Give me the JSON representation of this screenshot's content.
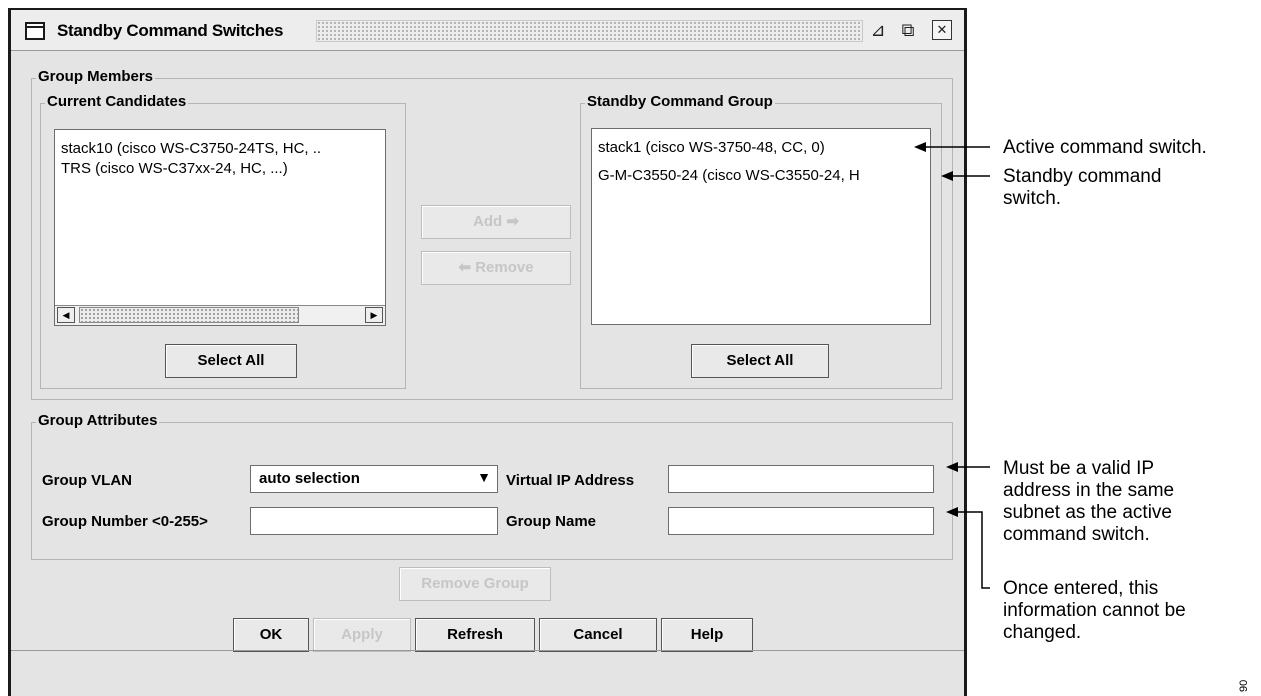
{
  "window": {
    "title": "Standby Command Switches"
  },
  "group_members": {
    "legend": "Group Members",
    "current_candidates": {
      "legend": "Current Candidates",
      "items": [
        "stack10 (cisco WS-C3750-24TS, HC, ..",
        "TRS (cisco WS-C37xx-24, HC, ...)"
      ],
      "select_all_label": "Select All"
    },
    "add_label": "Add",
    "remove_label": "Remove",
    "standby_group": {
      "legend": "Standby Command Group",
      "items": [
        "stack1 (cisco WS-3750-48, CC, 0)",
        "G-M-C3550-24 (cisco WS-C3550-24, H"
      ],
      "select_all_label": "Select All"
    }
  },
  "group_attributes": {
    "legend": "Group Attributes",
    "vlan_label": "Group VLAN",
    "vlan_value": "auto selection",
    "number_label": "Group Number <0-255>",
    "virtual_ip_label": "Virtual IP Address",
    "name_label": "Group Name"
  },
  "buttons": {
    "remove_group": "Remove Group",
    "ok": "OK",
    "apply": "Apply",
    "refresh": "Refresh",
    "cancel": "Cancel",
    "help": "Help"
  },
  "annotations": {
    "active": "Active command switch.",
    "standby_1": "Standby command",
    "standby_2": "switch.",
    "ip_1": "Must be a valid IP",
    "ip_2": "address in the same",
    "ip_3": "subnet as the active",
    "ip_4": "command switch.",
    "once_1": "Once entered, this",
    "once_2": "information cannot be",
    "once_3": "changed."
  },
  "figure_number": "90"
}
